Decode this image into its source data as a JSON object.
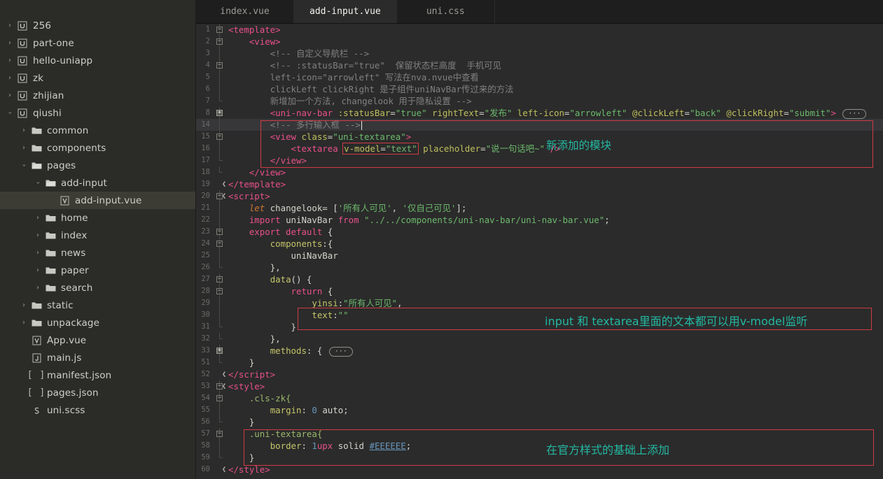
{
  "sidebar": {
    "items": [
      {
        "label": "256",
        "indent": 0,
        "chev": "right",
        "icon": "uniapp-project-icon",
        "selected": false
      },
      {
        "label": "part-one",
        "indent": 0,
        "chev": "right",
        "icon": "uniapp-project-icon",
        "selected": false
      },
      {
        "label": "hello-uniapp",
        "indent": 0,
        "chev": "right",
        "icon": "uniapp-project-icon",
        "selected": false
      },
      {
        "label": "zk",
        "indent": 0,
        "chev": "right",
        "icon": "uniapp-project-icon",
        "selected": false
      },
      {
        "label": "zhijian",
        "indent": 0,
        "chev": "right",
        "icon": "uniapp-project-icon",
        "selected": false
      },
      {
        "label": "qiushi",
        "indent": 0,
        "chev": "down",
        "icon": "uniapp-project-icon",
        "selected": false
      },
      {
        "label": "common",
        "indent": 1,
        "chev": "right",
        "icon": "folder-icon",
        "selected": false
      },
      {
        "label": "components",
        "indent": 1,
        "chev": "right",
        "icon": "folder-icon",
        "selected": false
      },
      {
        "label": "pages",
        "indent": 1,
        "chev": "down",
        "icon": "folder-open-icon",
        "selected": false
      },
      {
        "label": "add-input",
        "indent": 2,
        "chev": "down",
        "icon": "folder-open-icon",
        "selected": false
      },
      {
        "label": "add-input.vue",
        "indent": 3,
        "chev": "none",
        "icon": "vue-file-icon",
        "selected": true
      },
      {
        "label": "home",
        "indent": 2,
        "chev": "right",
        "icon": "folder-icon",
        "selected": false
      },
      {
        "label": "index",
        "indent": 2,
        "chev": "right",
        "icon": "folder-icon",
        "selected": false
      },
      {
        "label": "news",
        "indent": 2,
        "chev": "right",
        "icon": "folder-icon",
        "selected": false
      },
      {
        "label": "paper",
        "indent": 2,
        "chev": "right",
        "icon": "folder-icon",
        "selected": false
      },
      {
        "label": "search",
        "indent": 2,
        "chev": "right",
        "icon": "folder-icon",
        "selected": false
      },
      {
        "label": "static",
        "indent": 1,
        "chev": "right",
        "icon": "folder-icon",
        "selected": false
      },
      {
        "label": "unpackage",
        "indent": 1,
        "chev": "right",
        "icon": "folder-icon",
        "selected": false
      },
      {
        "label": "App.vue",
        "indent": 1,
        "chev": "none",
        "icon": "vue-file-icon",
        "selected": false
      },
      {
        "label": "main.js",
        "indent": 1,
        "chev": "none",
        "icon": "js-file-icon",
        "selected": false
      },
      {
        "label": "manifest.json",
        "indent": 1,
        "chev": "none",
        "icon": "json-file-icon",
        "selected": false
      },
      {
        "label": "pages.json",
        "indent": 1,
        "chev": "none",
        "icon": "json-file-icon",
        "selected": false
      },
      {
        "label": "uni.scss",
        "indent": 1,
        "chev": "none",
        "icon": "scss-file-icon",
        "selected": false
      }
    ]
  },
  "tabs": [
    {
      "label": "index.vue",
      "active": false
    },
    {
      "label": "add-input.vue",
      "active": true
    },
    {
      "label": "uni.css",
      "active": false
    }
  ],
  "annotations": [
    {
      "id": "new-module",
      "text": "新添加的模块",
      "color": "#23b8a2"
    },
    {
      "id": "v-model-tip",
      "text": "input 和  textarea里面的文本都可以用v-model监听",
      "color": "#23b8a2"
    },
    {
      "id": "style-tip",
      "text": "在官方样式的基础上添加",
      "color": "#23b8a2"
    }
  ],
  "colors": {
    "accent_annotation": "#23b8a2",
    "annotation_box": "#cf3b45",
    "editor_background": "#2b2b2b",
    "sidebar_background": "#2b2b28",
    "selected_row": "#3c3c35",
    "current_line": "#37373a",
    "tag": "#e8508a",
    "attribute": "#bfbf5e",
    "string": "#6cb96c",
    "comment": "#808080",
    "keyword": "#cc7832",
    "number": "#6897bb"
  },
  "code": [
    {
      "n": "1",
      "fold": "minus",
      "html": "<span class='t-tag'>&lt;template&gt;</span>"
    },
    {
      "n": "2",
      "fold": "minus",
      "html": "    <span class='t-tag'>&lt;view&gt;</span>"
    },
    {
      "n": "3",
      "fold": "line",
      "html": "        <span class='t-cmt'>&lt;!-- 自定义导航栏 --&gt;</span>"
    },
    {
      "n": "4",
      "fold": "minus",
      "html": "        <span class='t-cmt'>&lt;!-- :statusBar=\"true\"  保留状态栏高度  手机可见</span>"
    },
    {
      "n": "5",
      "fold": "line",
      "html": "        <span class='t-cmt'>left-icon=\"arrowleft\" 写法在nva.nvue中查看</span>"
    },
    {
      "n": "6",
      "fold": "line",
      "html": "        <span class='t-cmt'>clickLeft clickRight 是子组件uniNavBar传过来的方法</span>"
    },
    {
      "n": "7",
      "fold": "end",
      "html": "        <span class='t-cmt'>新增加一个方法, changelook 用于隐私设置 --&gt;</span>"
    },
    {
      "n": "8",
      "fold": "plus",
      "html": "        <span class='t-tag'>&lt;uni-nav-bar</span> <span class='t-attr'>:statusBar</span><span class='t-plain'>=</span><span class='t-str'>\"true\"</span> <span class='t-attr'>rightText</span><span class='t-plain'>=</span><span class='t-str'>\"发布\"</span> <span class='t-attr'>left-icon</span><span class='t-plain'>=</span><span class='t-str'>\"arrowleft\"</span> <span class='t-attr'>@clickLeft</span><span class='t-plain'>=</span><span class='t-str'>\"back\"</span> <span class='t-attr'>@clickRight</span><span class='t-plain'>=</span><span class='t-str'>\"submit\"</span><span class='t-tag'>&gt;</span> <span class='ellipsis-chip'>···</span>"
    },
    {
      "n": "14",
      "fold": "line",
      "current": true,
      "html": "        <span class='t-cmt'>&lt;!-- 多行输入框 --&gt;</span><span class='cursor'></span>"
    },
    {
      "n": "15",
      "fold": "minus",
      "html": "        <span class='t-tag'>&lt;view</span> <span class='t-attr'>class</span><span class='t-plain'>=</span><span class='t-str'>\"uni-textarea\"</span><span class='t-tag'>&gt;</span>"
    },
    {
      "n": "16",
      "fold": "line",
      "html": "            <span class='t-tag'>&lt;textarea</span> <span class='boxed-token'><span class='t-attr'>v-model</span><span class='t-plain'>=</span><span class='t-str'>\"text\"</span></span> <span class='t-attr'>placeholder</span><span class='t-plain'>=</span><span class='t-str'>\"说一句话吧~\"</span> <span class='t-tag'>/&gt;</span>"
    },
    {
      "n": "17",
      "fold": "end",
      "html": "        <span class='t-tag'>&lt;/view&gt;</span>"
    },
    {
      "n": "18",
      "fold": "end",
      "html": "    <span class='t-tag'>&lt;/view&gt;</span>"
    },
    {
      "n": "19",
      "fold": "arrow",
      "html": "<span class='t-tag'>&lt;/template&gt;</span>"
    },
    {
      "n": "20",
      "fold": "minus-arrow",
      "html": "<span class='t-tag'>&lt;script&gt;</span>"
    },
    {
      "n": "21",
      "fold": "line",
      "html": "    <span class='t-ital'>let</span> <span class='t-plain'>changelook= [</span><span class='t-str'>'所有人可见'</span><span class='t-plain'>, </span><span class='t-str'>'仅自己可见'</span><span class='t-plain'>];</span>"
    },
    {
      "n": "22",
      "fold": "line",
      "html": "    <span class='t-kw2'>import</span> <span class='t-plain'>uniNavBar</span> <span class='t-kw2'>from</span> <span class='t-str'>\"../../components/uni-nav-bar/uni-nav-bar.vue\"</span><span class='t-plain'>;</span>"
    },
    {
      "n": "23",
      "fold": "minus",
      "html": "    <span class='t-kw2'>export default</span> <span class='t-plain'>{</span>"
    },
    {
      "n": "24",
      "fold": "minus",
      "html": "        <span class='t-prop'>components</span><span class='t-plain'>:{</span>"
    },
    {
      "n": "25",
      "fold": "line",
      "html": "            <span class='t-plain'>uniNavBar</span>"
    },
    {
      "n": "26",
      "fold": "end",
      "html": "        <span class='t-plain'>},</span>"
    },
    {
      "n": "27",
      "fold": "minus",
      "html": "        <span class='t-prop'>data</span><span class='t-plain'>() {</span>"
    },
    {
      "n": "28",
      "fold": "minus",
      "html": "            <span class='t-kw2'>return</span> <span class='t-plain'>{</span>"
    },
    {
      "n": "29",
      "fold": "line",
      "html": "                <span class='t-prop'>yinsi</span><span class='t-plain'>:</span><span class='t-str'>\"所有人可见\"</span><span class='t-plain'>,</span>"
    },
    {
      "n": "30",
      "fold": "line",
      "html": "                <span class='t-prop'>text</span><span class='t-plain'>:</span><span class='t-str'>\"\"</span>"
    },
    {
      "n": "31",
      "fold": "end",
      "html": "            <span class='t-plain'>}</span>"
    },
    {
      "n": "32",
      "fold": "end",
      "html": "        <span class='t-plain'>},</span>"
    },
    {
      "n": "33",
      "fold": "plus",
      "html": "        <span class='t-prop'>methods</span><span class='t-plain'>: {</span> <span class='ellipsis-chip'>···</span>"
    },
    {
      "n": "51",
      "fold": "end",
      "html": "    <span class='t-plain'>}</span>"
    },
    {
      "n": "52",
      "fold": "arrow",
      "html": "<span class='t-tag'>&lt;/script&gt;</span>"
    },
    {
      "n": "53",
      "fold": "minus-arrow",
      "html": "<span class='t-tag'>&lt;style&gt;</span>"
    },
    {
      "n": "54",
      "fold": "minus",
      "html": "    <span class='t-sel'>.cls-zk{</span>"
    },
    {
      "n": "55",
      "fold": "line",
      "html": "        <span class='t-prop'>margin</span><span class='t-plain'>: </span><span class='t-num'>0</span> <span class='t-plain'>auto;</span>"
    },
    {
      "n": "56",
      "fold": "end",
      "html": "    <span class='t-plain'>}</span>"
    },
    {
      "n": "57",
      "fold": "minus",
      "html": "    <span class='t-sel'>.uni-textarea{</span>"
    },
    {
      "n": "58",
      "fold": "line",
      "html": "        <span class='t-prop'>border</span><span class='t-plain'>: </span><span class='t-num'>1</span><span class='t-css-unit'>upx</span> <span class='t-plain'>solid</span> <span class='t-hash'>#EEEEEE</span><span class='t-plain'>;</span>"
    },
    {
      "n": "59",
      "fold": "end",
      "html": "    <span class='t-plain'>}</span>"
    },
    {
      "n": "60",
      "fold": "arrow",
      "html": "<span class='t-tag'>&lt;/style&gt;</span>"
    }
  ]
}
